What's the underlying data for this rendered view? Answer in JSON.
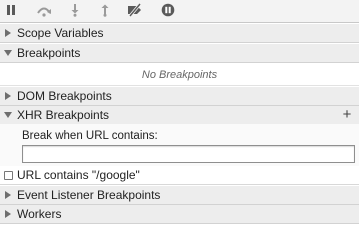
{
  "toolbar": {
    "buttons": [
      {
        "icon": "pause-icon"
      },
      {
        "icon": "step-over-icon"
      },
      {
        "icon": "step-into-icon"
      },
      {
        "icon": "step-out-icon"
      },
      {
        "icon": "deactivate-breakpoints-icon"
      },
      {
        "icon": "pause-on-exceptions-icon"
      }
    ]
  },
  "sections": {
    "scope": {
      "label": "Scope Variables",
      "expanded": false
    },
    "breakpoints": {
      "label": "Breakpoints",
      "expanded": true,
      "empty_message": "No Breakpoints"
    },
    "dom": {
      "label": "DOM Breakpoints",
      "expanded": false
    },
    "xhr": {
      "label": "XHR Breakpoints",
      "expanded": true,
      "add_label": "+",
      "prompt": "Break when URL contains:",
      "input_value": "",
      "items": [
        {
          "label": "URL contains \"/google\"",
          "checked": false
        }
      ]
    },
    "event": {
      "label": "Event Listener Breakpoints",
      "expanded": false
    },
    "workers": {
      "label": "Workers",
      "expanded": false
    }
  },
  "colors": {
    "header_bg": "#ededed",
    "toolbar_bg": "#f3f3f3",
    "icon": "#5a5a5a",
    "icon_disabled": "#9a9a9a"
  }
}
